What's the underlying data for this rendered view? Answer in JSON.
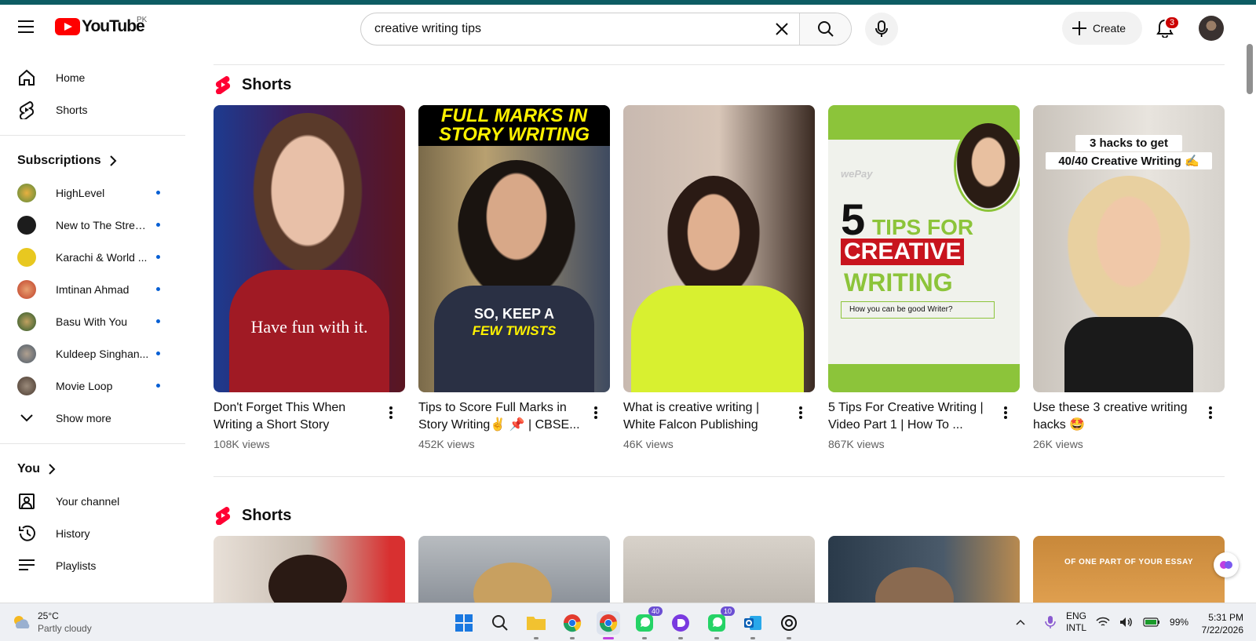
{
  "header": {
    "logo_text": "YouTube",
    "country": "PK",
    "search_value": "creative writing tips",
    "create_label": "Create",
    "notification_count": "3"
  },
  "sidebar": {
    "primary": [
      {
        "label": "Home",
        "icon": "home-icon"
      },
      {
        "label": "Shorts",
        "icon": "shorts-icon"
      }
    ],
    "subscriptions_heading": "Subscriptions",
    "subscriptions": [
      {
        "label": "HighLevel",
        "color": "#c99a3a"
      },
      {
        "label": "New to The Stree...",
        "color": "#1c1c1c"
      },
      {
        "label": "Karachi & World ...",
        "color": "#e8c820"
      },
      {
        "label": "Imtinan Ahmad",
        "color": "#d44a2a"
      },
      {
        "label": "Basu With You",
        "color": "#3a6a3a"
      },
      {
        "label": "Kuldeep Singhan...",
        "color": "#5a6a7a"
      },
      {
        "label": "Movie Loop",
        "color": "#6a4a3a"
      }
    ],
    "show_more": "Show more",
    "you_heading": "You",
    "you_items": [
      {
        "label": "Your channel",
        "icon": "user-icon"
      },
      {
        "label": "History",
        "icon": "history-icon"
      },
      {
        "label": "Playlists",
        "icon": "playlist-icon"
      }
    ]
  },
  "shelves": [
    {
      "title": "Shorts",
      "cards": [
        {
          "title": "Don't Forget This When Writing a Short Story",
          "views": "108K views",
          "overlay": "Have fun with it."
        },
        {
          "title": "Tips to Score Full Marks in Story Writing✌️ 📌 | CBSE...",
          "views": "452K views",
          "overlay_top_1": "FULL MARKS IN",
          "overlay_top_2": "STORY WRITING",
          "overlay_mid_1": "SO, KEEP A",
          "overlay_mid_2": "FEW TWISTS"
        },
        {
          "title": "What is creative writing | White Falcon Publishing",
          "views": "46K views"
        },
        {
          "title": "5 Tips For Creative Writing | Video Part 1 | How To ...",
          "views": "867K views",
          "brand": "wePay",
          "big_1": "5",
          "big_2": "TIPS FOR",
          "big_3": "CREATIVE",
          "big_4": "WRITING",
          "field": "How you can be good Writer?"
        },
        {
          "title": "Use these 3 creative writing hacks 🤩",
          "views": "26K views",
          "overlay_1": "3 hacks to get",
          "overlay_2": "40/40 Creative Writing ✍️"
        }
      ]
    },
    {
      "title": "Shorts",
      "card5_overlay": "OF ONE PART OF YOUR ESSAY"
    }
  ],
  "taskbar": {
    "weather_temp": "25°C",
    "weather_cond": "Partly cloudy",
    "lang_1": "ENG",
    "lang_2": "INTL",
    "battery": "99%",
    "time": "5:31 PM",
    "date": "7/22/2026",
    "badge_whatsapp1": "40",
    "badge_whatsapp2": "10"
  }
}
